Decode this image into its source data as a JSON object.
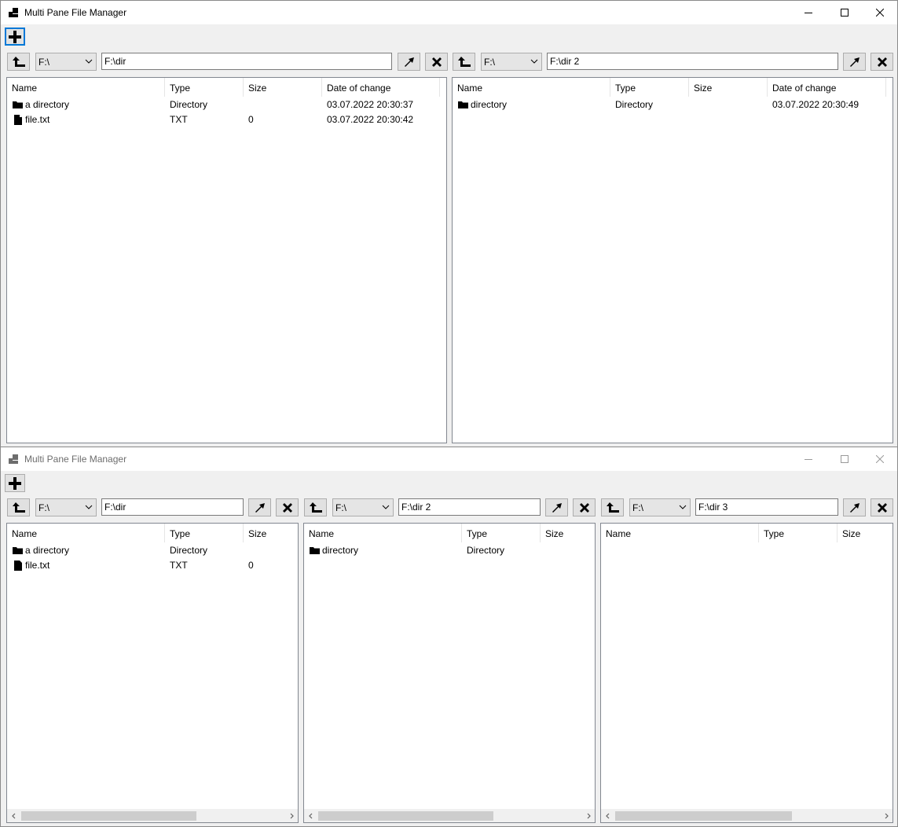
{
  "window_top": {
    "title": "Multi Pane File Manager",
    "controls": [
      "minimize-icon",
      "maximize-icon",
      "close-icon"
    ],
    "add_pane_icon": "plus-icon",
    "panes": [
      {
        "drive": "F:\\",
        "path": "F:\\dir",
        "columns": [
          "Name",
          "Type",
          "Size",
          "Date of change"
        ],
        "rows": [
          {
            "icon": "folder-icon",
            "name": "a directory",
            "type": "Directory",
            "size": "",
            "date": "03.07.2022 20:30:37"
          },
          {
            "icon": "file-icon",
            "name": "file.txt",
            "type": "TXT",
            "size": "0",
            "date": "03.07.2022 20:30:42"
          }
        ]
      },
      {
        "drive": "F:\\",
        "path": "F:\\dir 2",
        "columns": [
          "Name",
          "Type",
          "Size",
          "Date of change"
        ],
        "rows": [
          {
            "icon": "folder-icon",
            "name": "directory",
            "type": "Directory",
            "size": "",
            "date": "03.07.2022 20:30:49"
          }
        ]
      }
    ]
  },
  "window_bottom": {
    "title": "Multi Pane File Manager",
    "controls": [
      "minimize-icon",
      "maximize-icon",
      "close-icon"
    ],
    "add_pane_icon": "plus-icon",
    "panes": [
      {
        "drive": "F:\\",
        "path": "F:\\dir",
        "columns": [
          "Name",
          "Type",
          "Size"
        ],
        "rows": [
          {
            "icon": "folder-icon",
            "name": "a directory",
            "type": "Directory",
            "size": ""
          },
          {
            "icon": "file-icon",
            "name": "file.txt",
            "type": "TXT",
            "size": "0"
          }
        ]
      },
      {
        "drive": "F:\\",
        "path": "F:\\dir 2",
        "columns": [
          "Name",
          "Type",
          "Size"
        ],
        "rows": [
          {
            "icon": "folder-icon",
            "name": "directory",
            "type": "Directory",
            "size": ""
          }
        ]
      },
      {
        "drive": "F:\\",
        "path": "F:\\dir 3",
        "columns": [
          "Name",
          "Type",
          "Size"
        ],
        "rows": []
      }
    ]
  },
  "colors": {
    "window_bg": "#f0f0f0",
    "titlebar_bg": "#ffffff",
    "focus_border": "#0078d7",
    "inactive_title": "#6d6d6d"
  }
}
